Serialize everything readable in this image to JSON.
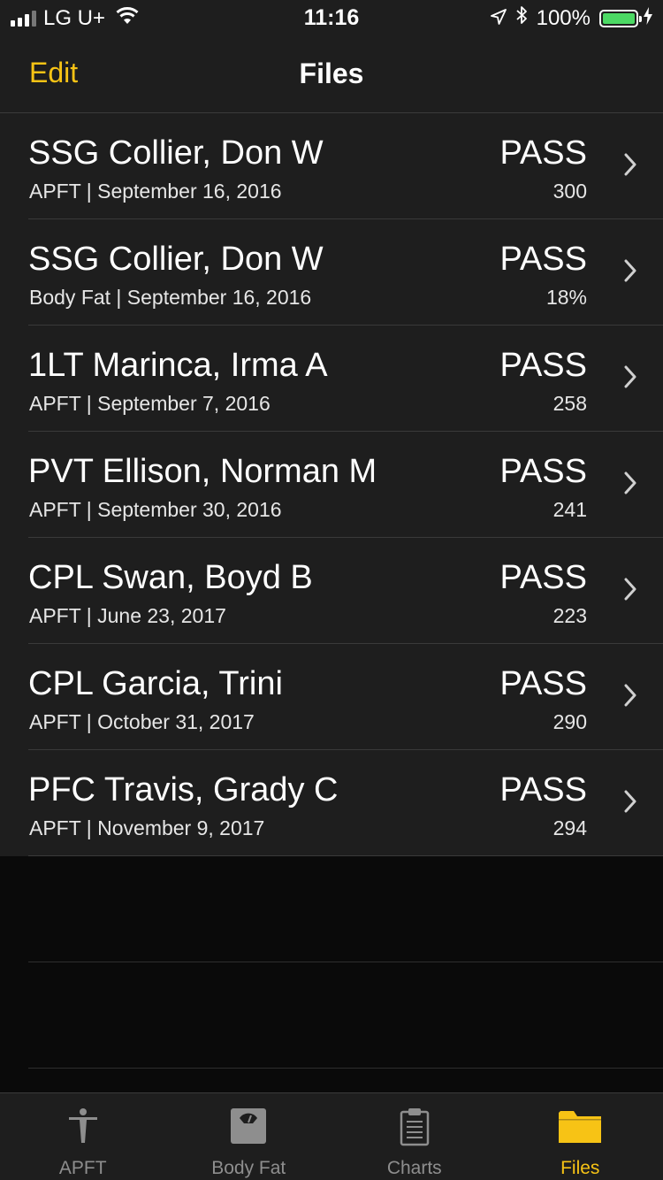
{
  "status_bar": {
    "carrier": "LG U+",
    "time": "11:16",
    "battery": "100%"
  },
  "nav": {
    "edit_label": "Edit",
    "title": "Files"
  },
  "files": [
    {
      "name": "SSG Collier, Don W",
      "subtitle": "APFT | September 16, 2016",
      "status": "PASS",
      "score": "300"
    },
    {
      "name": "SSG Collier, Don W",
      "subtitle": "Body Fat | September 16, 2016",
      "status": "PASS",
      "score": "18%"
    },
    {
      "name": "1LT Marinca, Irma A",
      "subtitle": "APFT | September 7, 2016",
      "status": "PASS",
      "score": "258"
    },
    {
      "name": "PVT Ellison, Norman M",
      "subtitle": "APFT | September 30, 2016",
      "status": "PASS",
      "score": "241"
    },
    {
      "name": "CPL Swan, Boyd B",
      "subtitle": "APFT | June 23, 2017",
      "status": "PASS",
      "score": "223"
    },
    {
      "name": "CPL Garcia, Trini",
      "subtitle": "APFT | October 31, 2017",
      "status": "PASS",
      "score": "290"
    },
    {
      "name": "PFC Travis, Grady C",
      "subtitle": "APFT | November 9, 2017",
      "status": "PASS",
      "score": "294"
    }
  ],
  "tabs": [
    {
      "label": "APFT",
      "icon": "soldier-icon",
      "active": false
    },
    {
      "label": "Body Fat",
      "icon": "scale-icon",
      "active": false
    },
    {
      "label": "Charts",
      "icon": "clipboard-icon",
      "active": false
    },
    {
      "label": "Files",
      "icon": "folder-icon",
      "active": true
    }
  ],
  "colors": {
    "accent": "#f7c315",
    "background": "#1e1e1e",
    "inactive_tab": "#8e8e8e",
    "battery": "#4cd964"
  }
}
